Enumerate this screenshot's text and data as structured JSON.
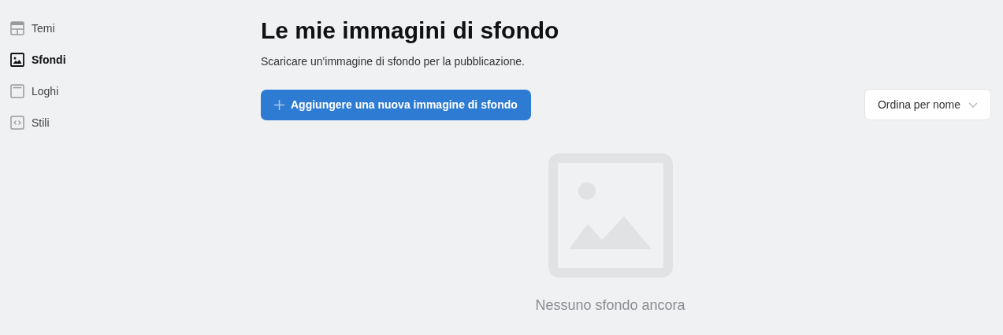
{
  "sidebar": {
    "items": [
      {
        "label": "Temi",
        "kind": "layout",
        "selected": false
      },
      {
        "label": "Sfondi",
        "kind": "image",
        "selected": true
      },
      {
        "label": "Loghi",
        "kind": "logo",
        "selected": false
      },
      {
        "label": "Stili",
        "kind": "code",
        "selected": false
      }
    ]
  },
  "title": "Le mie immagini di sfondo",
  "subtitle": "Scaricare un'immagine di sfondo per la pubblicazione.",
  "add_button": "Aggiungere una nuova immagine di sfondo",
  "sort": {
    "value": "Ordina per nome"
  },
  "empty_message": "Nessuno sfondo ancora"
}
